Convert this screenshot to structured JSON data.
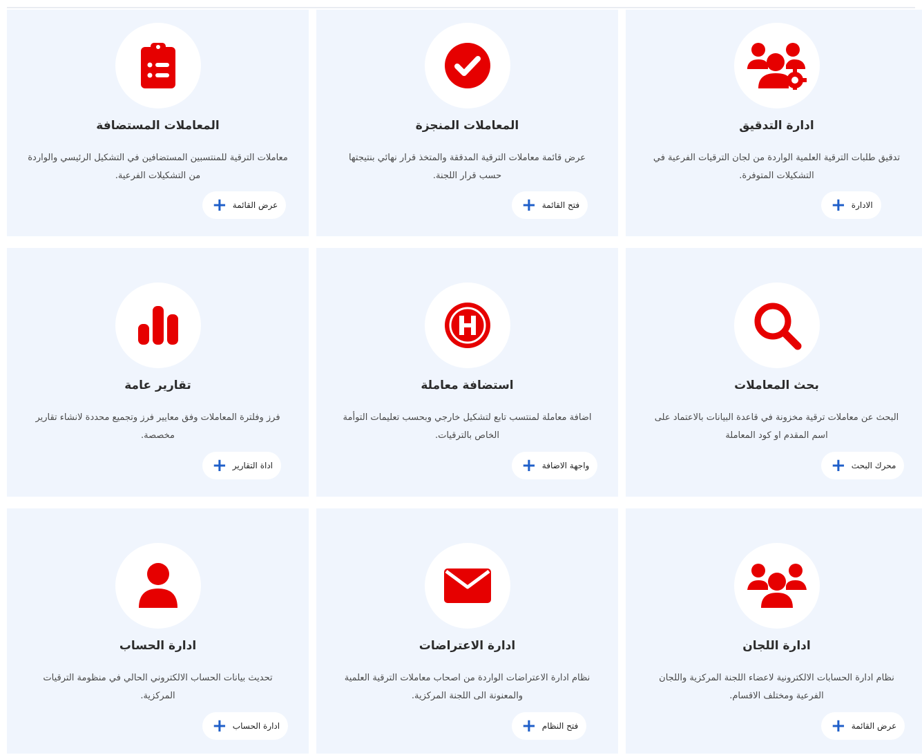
{
  "accent_color": "#e60000",
  "button_icon_color": "#1f5fc9",
  "card_background": "#f0f5fd",
  "cards": [
    {
      "icon": "users-gear-icon",
      "title": "ادارة التدقيق",
      "description": "تدقيق طلبات الترقية العلمية الواردة من لجان الترقيات الفرعية في التشكيلات المتوفرة.",
      "button_label": "الادارة"
    },
    {
      "icon": "check-circle-icon",
      "title": "المعاملات المنجزة",
      "description": "عرض قائمة معاملات الترقية المدققة والمتخذ قرار نهائي بنتيجتها حسب قرار اللجنة.",
      "button_label": "فتح القائمة"
    },
    {
      "icon": "clipboard-list-icon",
      "title": "المعاملات المستضافة",
      "description": "معاملات الترقية للمنتسبين المستضافين في التشكيل الرئيسي والواردة من التشكيلات الفرعية.",
      "button_label": "عرض القائمة"
    },
    {
      "icon": "search-icon",
      "title": "بحث المعاملات",
      "description": "البحث عن معاملات ترقية مخزونة في قاعدة البيانات بالاعتماد على اسم المقدم او كود المعاملة",
      "button_label": "محرك البحث"
    },
    {
      "icon": "hospital-h-icon",
      "title": "استضافة معاملة",
      "description": "اضافة معاملة لمنتسب تابع لتشكيل خارجي وبحسب تعليمات التوأمة الخاص بالترقيات.",
      "button_label": "واجهة الاضافة"
    },
    {
      "icon": "bar-chart-icon",
      "title": "تقارير عامة",
      "description": "فرز وفلترة المعاملات وفق معايير فرز وتجميع محددة لانشاء تقارير مخصصة.",
      "button_label": "اداة التقارير"
    },
    {
      "icon": "users-icon",
      "title": "ادارة اللجان",
      "description": "نظام ادارة الحسابات الالكترونية لاعضاء اللجنة المركزية واللجان الفرعية ومختلف الاقسام.",
      "button_label": "عرض القائمة"
    },
    {
      "icon": "envelope-icon",
      "title": "ادارة الاعتراضات",
      "description": "نظام ادارة الاعتراضات الواردة من اصحاب معاملات الترقية العلمية والمعنونة الى اللجنة المركزية.",
      "button_label": "فتح النظام"
    },
    {
      "icon": "user-icon",
      "title": "ادارة الحساب",
      "description": "تحديث بيانات الحساب الالكتروني الحالي في منظومة الترقيات المركزية.",
      "button_label": "ادارة الحساب"
    }
  ]
}
